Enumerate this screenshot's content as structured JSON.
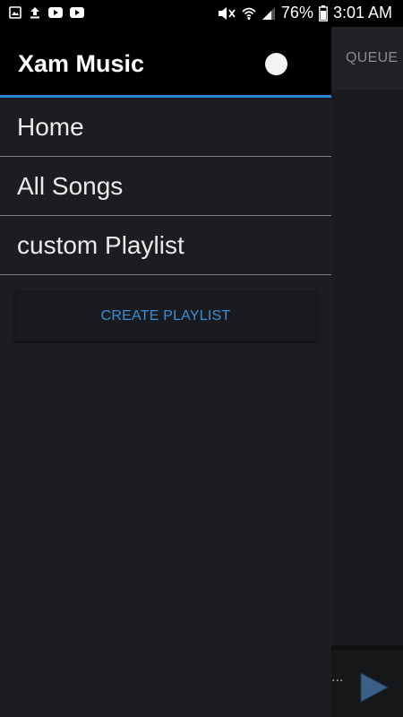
{
  "status_bar": {
    "left_icons": [
      "image-icon",
      "upload-icon",
      "youtube-icon",
      "youtube-icon"
    ],
    "right_icons": [
      "mute-icon",
      "wifi-icon",
      "signal-icon"
    ],
    "battery": "76%",
    "time": "3:01 AM"
  },
  "drawer": {
    "title": "Xam Music",
    "menu_items": [
      {
        "label": "Home"
      },
      {
        "label": "All Songs"
      },
      {
        "label": "custom Playlist"
      }
    ],
    "create_playlist_label": "CREATE PLAYLIST"
  },
  "main": {
    "queue_tab_label": "QUEUE",
    "now_playing_text": "..."
  },
  "colors": {
    "accent": "#2e86d6",
    "drawer_bg": "#1c1d21",
    "header_bg": "#000000",
    "button_text": "#3a8fd9"
  }
}
